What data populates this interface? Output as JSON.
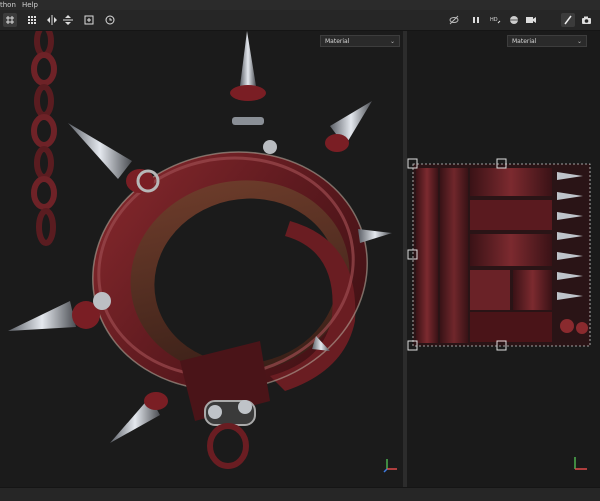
{
  "menu": {
    "python_label": "thon",
    "help_label": "Help"
  },
  "viewport_3d": {
    "material_dropdown": "Material"
  },
  "viewport_2d": {
    "material_dropdown": "Material"
  },
  "colors": {
    "background": "#1b1b1b",
    "toolbar": "#262626",
    "accent_red": "#7a1e24",
    "metal": "#c9ced6"
  },
  "icons": {
    "toolbar_left": [
      "grid-icon",
      "grid-dots-icon",
      "mirror-x-icon",
      "mirror-y-icon",
      "frame-icon",
      "clock-icon"
    ],
    "toolbar_right": [
      "eye-off-icon",
      "pause-icon",
      "quality-icon",
      "sphere-icon",
      "camera-icon",
      "light-icon",
      "brush-icon",
      "screenshot-icon"
    ]
  }
}
